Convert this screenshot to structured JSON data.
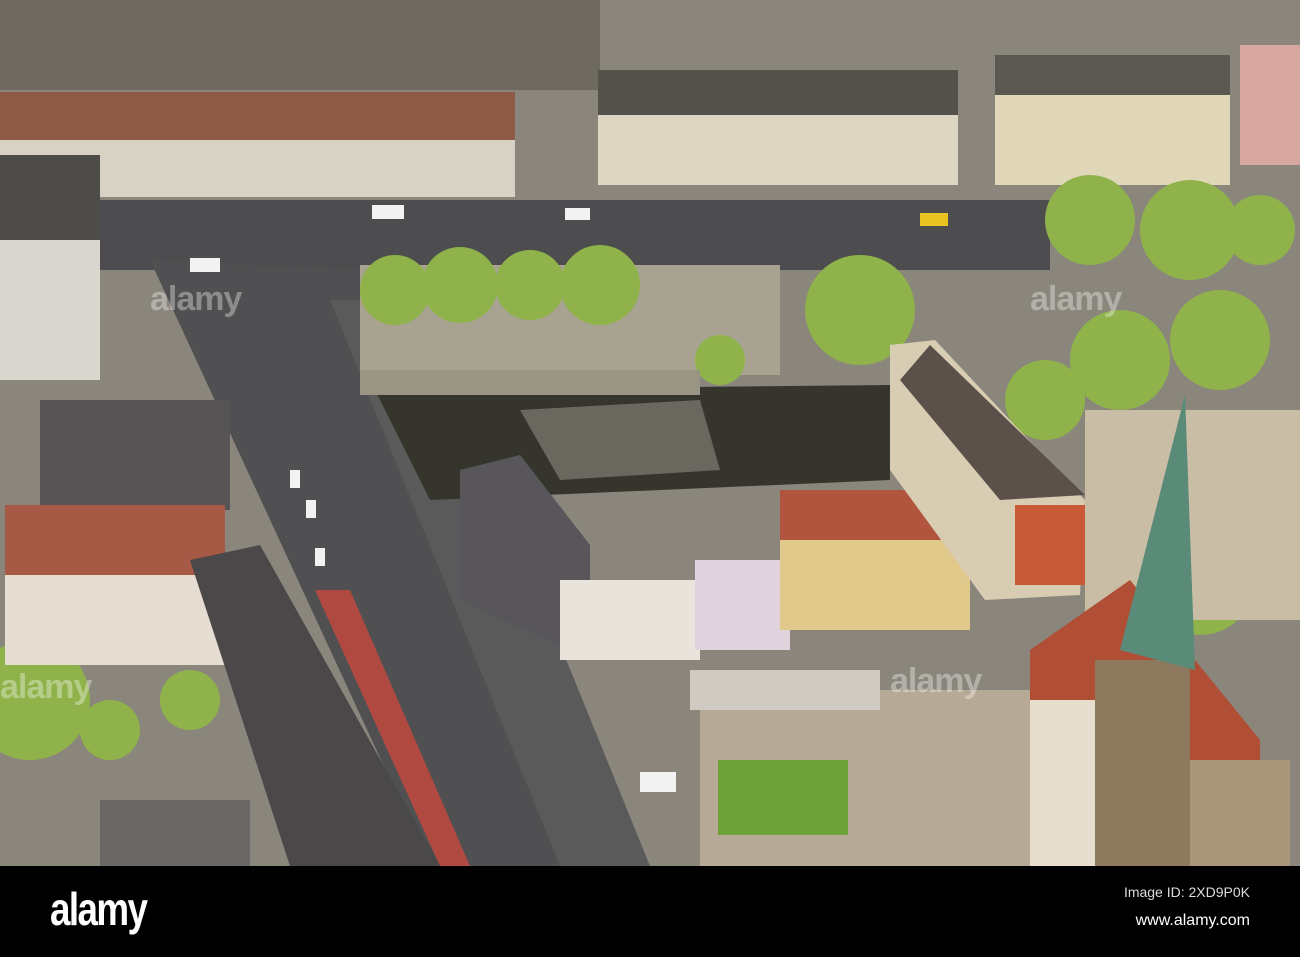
{
  "photo": {
    "description_label": "aerial-city-river-photo",
    "watermark": "alamy"
  },
  "footer": {
    "logo": "alamy",
    "image_id": "Image ID: 2XD9P0K",
    "website": "www.alamy.com"
  }
}
